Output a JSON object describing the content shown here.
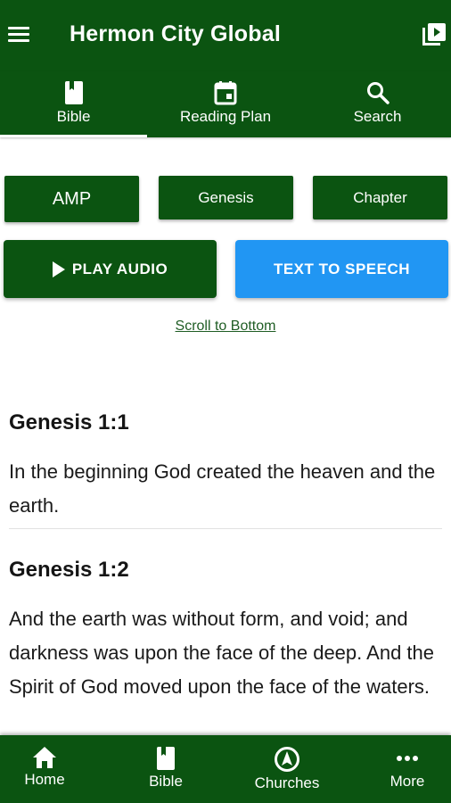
{
  "app": {
    "title": "Hermon City Global"
  },
  "tabs": [
    {
      "label": "Bible",
      "icon": "book-icon",
      "active": true
    },
    {
      "label": "Reading Plan",
      "icon": "calendar-icon"
    },
    {
      "label": "Search",
      "icon": "search-icon"
    }
  ],
  "selectors": {
    "version": "AMP",
    "book": "Genesis",
    "chapter": "Chapter"
  },
  "actions": {
    "play_audio": "PLAY AUDIO",
    "text_to_speech": "TEXT TO SPEECH",
    "scroll_link": "Scroll to Bottom"
  },
  "verses": [
    {
      "ref": "Genesis 1:1",
      "text": "In the beginning God created the heaven and the earth."
    },
    {
      "ref": "Genesis 1:2",
      "text": "And the earth was without form, and void; and darkness was upon the face of the deep. And the Spirit of God moved upon the face of the waters."
    }
  ],
  "bottom_nav": [
    {
      "label": "Home",
      "icon": "home-icon"
    },
    {
      "label": "Bible",
      "icon": "book-icon"
    },
    {
      "label": "Churches",
      "icon": "compass-icon"
    },
    {
      "label": "More",
      "icon": "more-dots-icon"
    }
  ],
  "colors": {
    "primary": "#0b5411",
    "accent": "#2196f3"
  }
}
